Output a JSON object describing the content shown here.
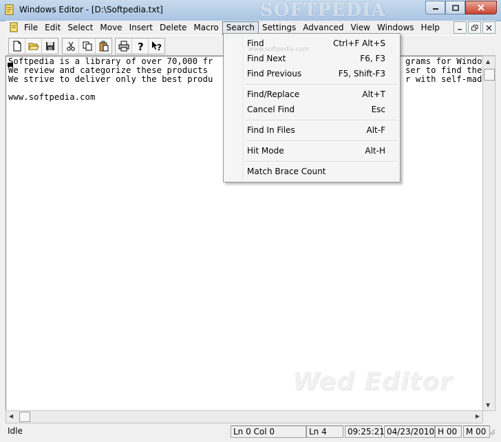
{
  "window": {
    "title": "Windows Editor - [D:\\Softpedia.txt]",
    "watermark_logo": "SOFTPEDIA",
    "app_watermark": "Wed Editor"
  },
  "menubar": {
    "items": [
      "File",
      "Edit",
      "Select",
      "Move",
      "Insert",
      "Delete",
      "Macro",
      "Search",
      "Settings",
      "Advanced",
      "View",
      "Windows",
      "Help"
    ],
    "active": "Search"
  },
  "search_menu": {
    "items": [
      {
        "label": "Find",
        "shortcut": "Ctrl+F Alt+S"
      },
      {
        "label": "Find Next",
        "shortcut": "F6, F3"
      },
      {
        "label": "Find Previous",
        "shortcut": "F5, Shift-F3"
      },
      {
        "label": "Find/Replace",
        "shortcut": "Alt+T"
      },
      {
        "label": "Cancel Find",
        "shortcut": "Esc"
      },
      {
        "label": "Find In Files",
        "shortcut": "Alt-F"
      },
      {
        "label": "Hit Mode",
        "shortcut": "Alt-H"
      },
      {
        "label": "Match Brace Count",
        "shortcut": ""
      }
    ],
    "overlay_url": "www.softpedia.com"
  },
  "editor": {
    "lines": [
      "Softpedia is a library of over 70,000 fr",
      "We review and categorize these products",
      "We strive to deliver only the best produ",
      "",
      "www.softpedia.com"
    ],
    "right_fragments": [
      "grams for Window",
      "ser to find the",
      "r with self-made"
    ]
  },
  "statusbar": {
    "state": "Idle",
    "position": "Ln 0 Col 0",
    "lines": "Ln 4",
    "time": "09:25:21",
    "date": "04/23/2010",
    "h": "H 00",
    "m": "M 00"
  }
}
